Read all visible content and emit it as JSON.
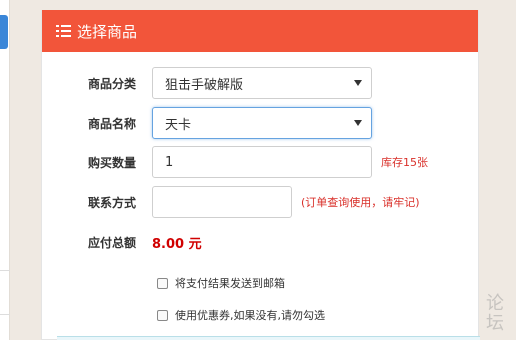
{
  "panel": {
    "title": "选择商品",
    "header_color": "#f2553a",
    "icon": "list-icon"
  },
  "form": {
    "category": {
      "label": "商品分类",
      "value": "狙击手破解版"
    },
    "product": {
      "label": "商品名称",
      "value": "天卡"
    },
    "quantity": {
      "label": "购买数量",
      "value": "1",
      "stock_hint": "库存15张"
    },
    "contact": {
      "label": "联系方式",
      "value": "",
      "hint": "(订单查询使用，请牢记)"
    },
    "total": {
      "label": "应付总额",
      "value": "8.00 元"
    },
    "options": [
      {
        "label": "将支付结果发送到邮箱",
        "checked": false
      },
      {
        "label": "使用优惠券,如果没有,请勿勾选",
        "checked": false
      }
    ]
  },
  "watermark": {
    "text": "论坛"
  }
}
